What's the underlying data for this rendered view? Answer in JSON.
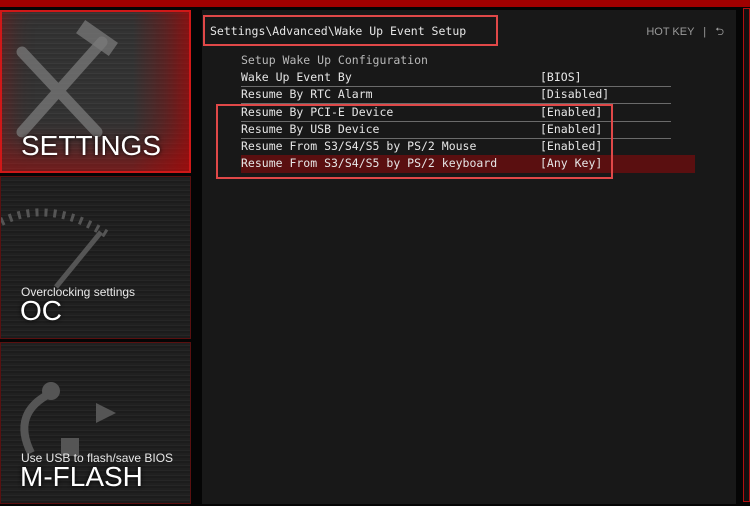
{
  "sidebar": {
    "items": [
      {
        "title": "SETTINGS",
        "subtitle": "",
        "icon": "tools-icon",
        "active": true
      },
      {
        "title": "OC",
        "subtitle": "Overclocking settings",
        "icon": "gauge-icon",
        "active": false
      },
      {
        "title": "M-FLASH",
        "subtitle": "Use USB to flash/save BIOS",
        "icon": "usb-icon",
        "active": false
      }
    ]
  },
  "header": {
    "breadcrumb": "Settings\\Advanced\\Wake Up Event Setup",
    "hotkey": "HOT KEY",
    "separator": "|",
    "back_icon": "back-arrow-icon"
  },
  "section_title": "Setup Wake Up Configuration",
  "rows": [
    {
      "label": "Wake Up Event By",
      "value": "[BIOS]"
    },
    {
      "label": "Resume By RTC Alarm",
      "value": "[Disabled]"
    },
    {
      "label": "Resume By PCI-E Device",
      "value": "[Enabled]"
    },
    {
      "label": "Resume By USB Device",
      "value": "[Enabled]"
    },
    {
      "label": "Resume From S3/S4/S5 by PS/2 Mouse",
      "value": "[Enabled]"
    },
    {
      "label": "Resume From S3/S4/S5 by PS/2 keyboard",
      "value": "[Any Key]",
      "selected": true
    }
  ],
  "colors": {
    "accent": "#d01818",
    "selected_row": "#5a0f10",
    "annotation": "#e04848"
  }
}
